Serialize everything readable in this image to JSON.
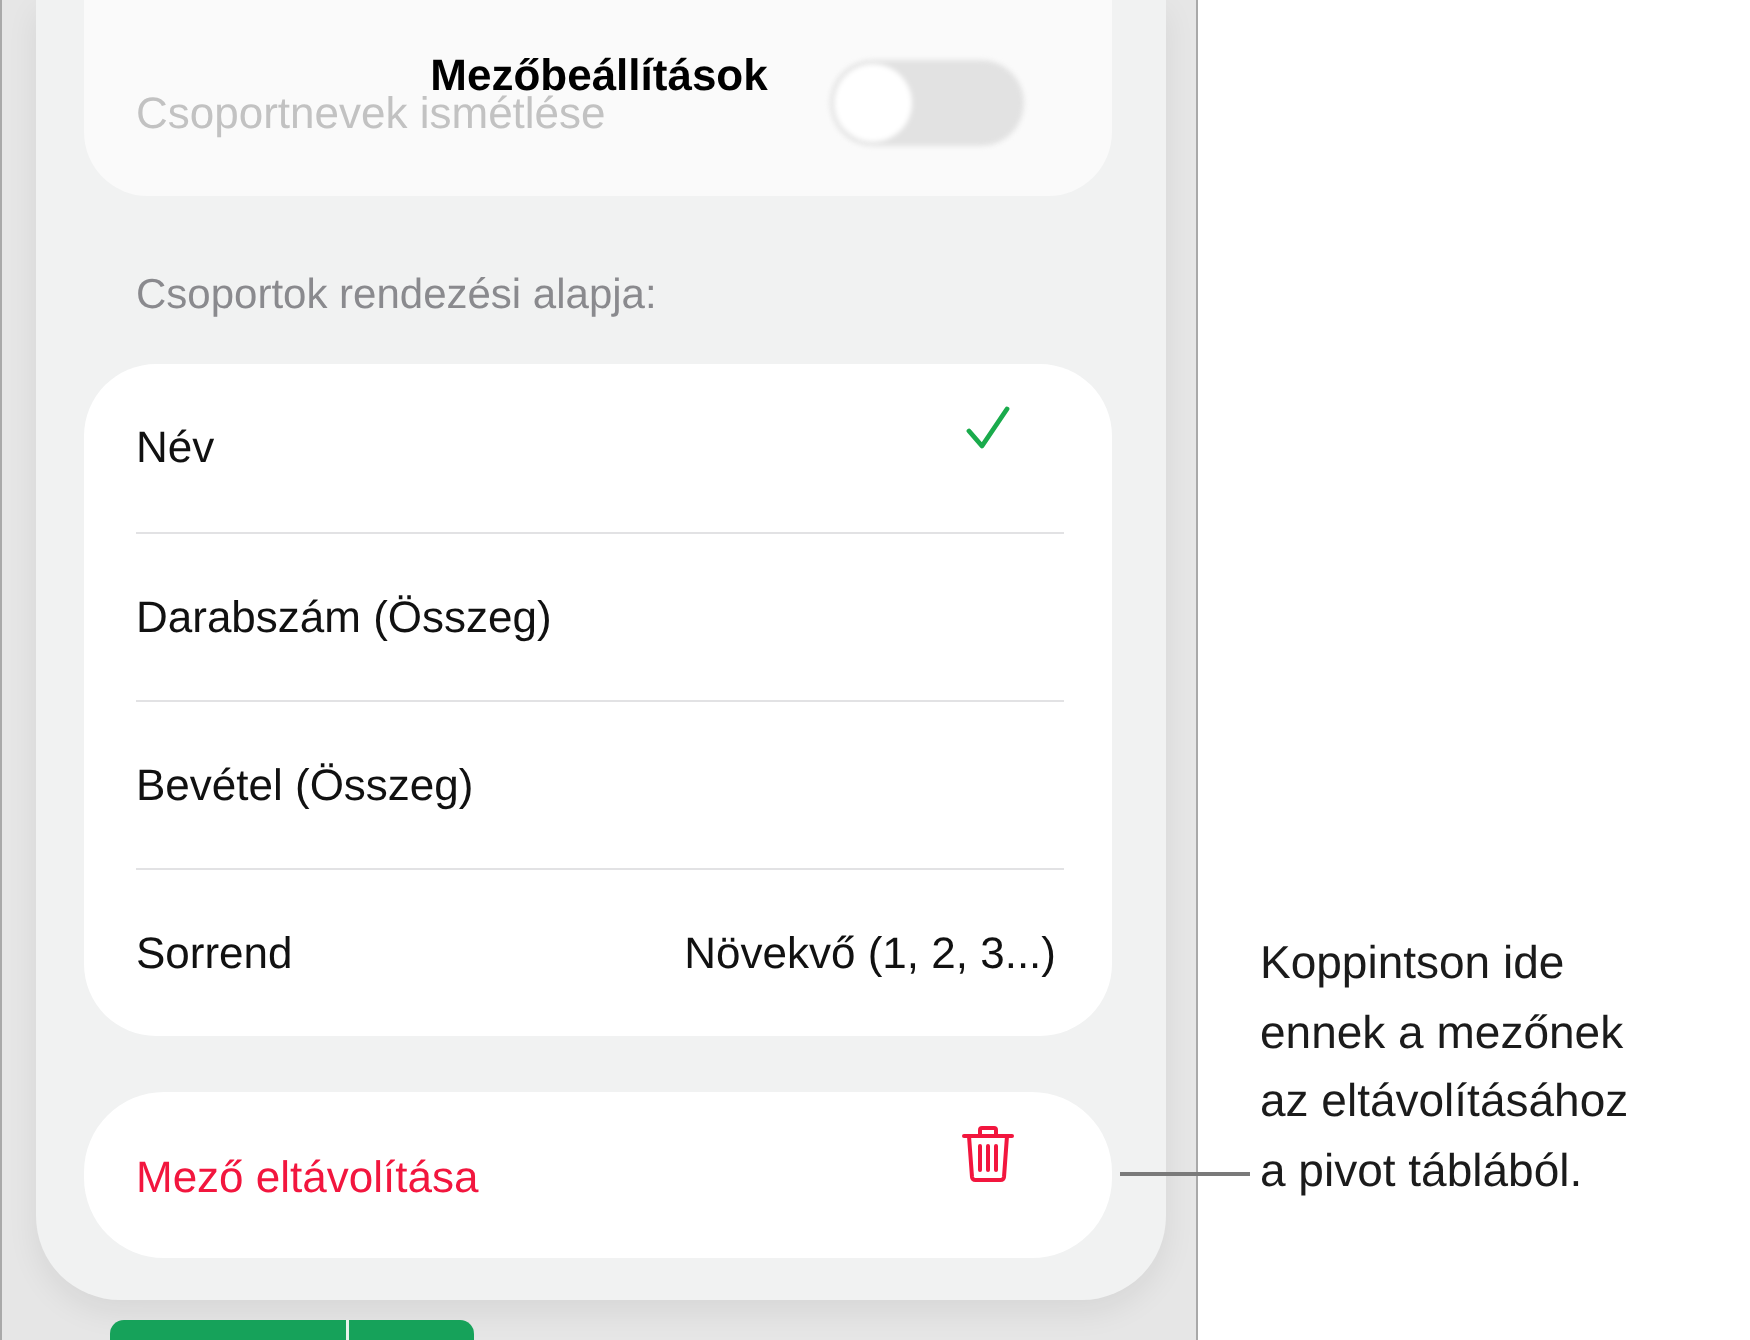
{
  "dialog": {
    "title": "Mezőbeállítások"
  },
  "background_card": {
    "label": "Csoportnevek ismétlése",
    "toggle": {
      "on": false
    }
  },
  "sort_section": {
    "header": "Csoportok rendezési alapja:",
    "rows": [
      {
        "kind": "option",
        "label": "Név",
        "selected": true
      },
      {
        "kind": "option",
        "label": "Darabszám (Összeg)",
        "selected": false
      },
      {
        "kind": "option",
        "label": "Bevétel (Összeg)",
        "selected": false
      },
      {
        "kind": "value",
        "label": "Sorrend",
        "value": "Növekvő (1, 2, 3...)"
      }
    ]
  },
  "remove_button": {
    "label": "Mező eltávolítása"
  },
  "callout": {
    "text": "Koppintson ide ennek a mezőnek az eltávolításához a pivot táblából."
  }
}
